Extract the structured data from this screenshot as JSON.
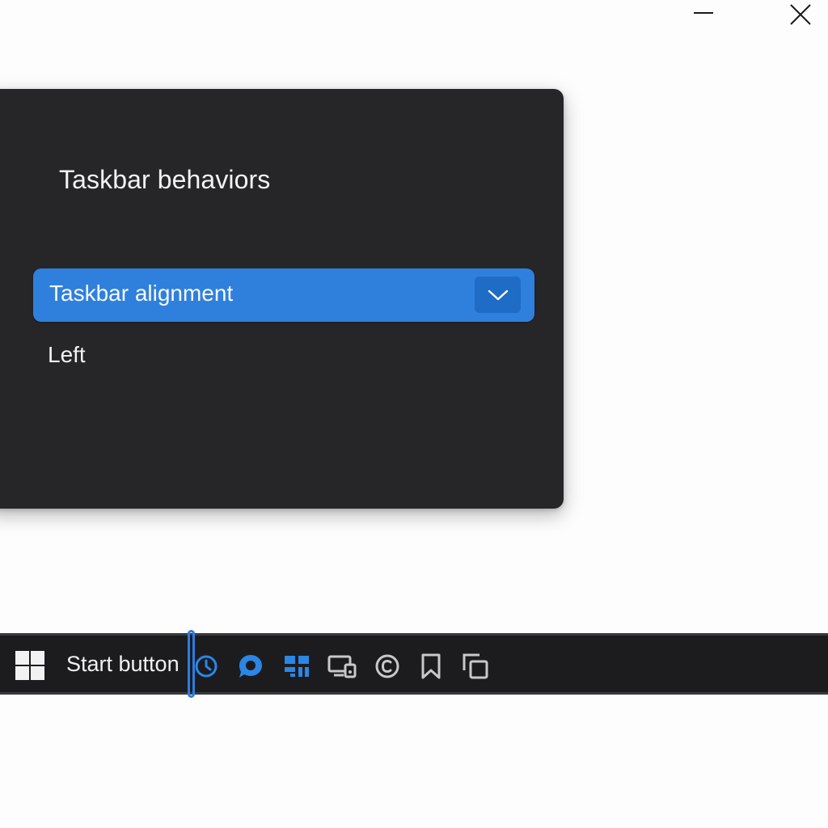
{
  "window_controls": {
    "minimize_icon": "minimize-icon",
    "close_icon": "close-icon"
  },
  "panel": {
    "title": "Taskbar behaviors",
    "dropdown": {
      "label": "Taskbar alignment",
      "chevron_icon": "chevron-down-icon",
      "accent_color": "#2f80dc"
    },
    "options": [
      "Left"
    ]
  },
  "taskbar": {
    "start_button": {
      "icon": "windows-logo-icon",
      "label": "Start button"
    },
    "focus_color": "#2b7de0",
    "icons": [
      {
        "name": "clock-icon",
        "color": "#2b86e6"
      },
      {
        "name": "chat-icon",
        "color": "#2b86e6"
      },
      {
        "name": "widgets-icon",
        "color": "#2b86e6"
      },
      {
        "name": "devices-icon",
        "color": "#c8c8c8"
      },
      {
        "name": "copyright-icon",
        "color": "#c8c8c8"
      },
      {
        "name": "bookmark-icon",
        "color": "#c8c8c8"
      },
      {
        "name": "task-view-icon",
        "color": "#c8c8c8"
      }
    ]
  }
}
